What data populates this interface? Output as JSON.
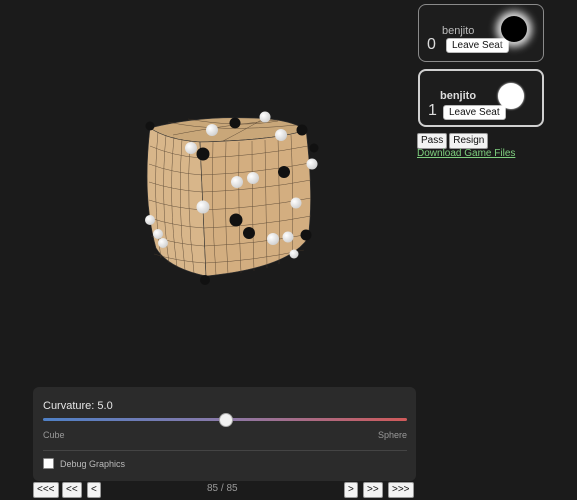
{
  "players": [
    {
      "score": "0",
      "name": "benjito",
      "leave_label": "Leave Seat",
      "stone": "black",
      "active": false
    },
    {
      "score": "1",
      "name": "benjito",
      "leave_label": "Leave Seat",
      "stone": "white",
      "active": true
    }
  ],
  "actions": {
    "pass_label": "Pass",
    "resign_label": "Resign",
    "download_label": "Download Game Files"
  },
  "curvature": {
    "label": "Curvature: 5.0",
    "value": 5.0,
    "fraction": 0.5,
    "min_label": "Cube",
    "max_label": "Sphere"
  },
  "debug": {
    "label": "Debug Graphics",
    "checked": false
  },
  "nav": {
    "first": "<<<",
    "prev_many": "<<",
    "prev": "<",
    "next": ">",
    "next_many": ">>",
    "last": ">>>",
    "position": "85 / 85"
  },
  "colors": {
    "board": "#d8b68a",
    "grid": "#4a3a2a",
    "background": "#1b1b1b",
    "link": "#7fd07f"
  }
}
